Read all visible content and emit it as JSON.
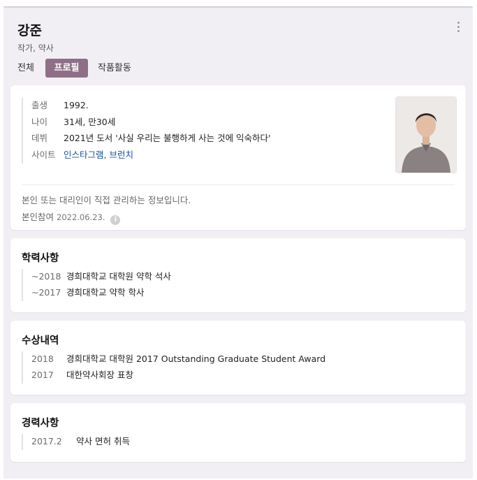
{
  "header": {
    "name": "강준",
    "roles": "작가, 약사"
  },
  "tabs": [
    {
      "label": "전체",
      "active": false
    },
    {
      "label": "프로필",
      "active": true
    },
    {
      "label": "작품활동",
      "active": false
    }
  ],
  "profile": {
    "rows": [
      {
        "key": "출생",
        "value": "1992."
      },
      {
        "key": "나이",
        "value": "31세, 만30세"
      },
      {
        "key": "데뷔",
        "value": "2021년 도서 '사실 우리는 불행하게 사는 것에 익숙하다'"
      },
      {
        "key": "사이트",
        "value": "인스타그램, 브런치"
      }
    ],
    "note": "본인 또는 대리인이 직접 관리하는 정보입니다.",
    "verified_label": "본인참여",
    "verified_date": "2022.06.23.",
    "info_icon": "i"
  },
  "education": {
    "title": "학력사항",
    "items": [
      {
        "year": "~2018",
        "desc": "경희대학교 대학원 약학 석사"
      },
      {
        "year": "~2017",
        "desc": "경희대학교 약학 학사"
      }
    ]
  },
  "awards": {
    "title": "수상내역",
    "items": [
      {
        "year": "2018",
        "desc": "경희대학교 대학원 2017 Outstanding Graduate Student Award"
      },
      {
        "year": "2017",
        "desc": "대한약사회장 표창"
      }
    ]
  },
  "career": {
    "title": "경력사항",
    "items": [
      {
        "year": "2017.2",
        "desc": "약사 면허 취득"
      }
    ]
  },
  "colors": {
    "accent": "#8f6f87",
    "link": "#1b4f9c",
    "panel_bg": "#f2eff4"
  }
}
